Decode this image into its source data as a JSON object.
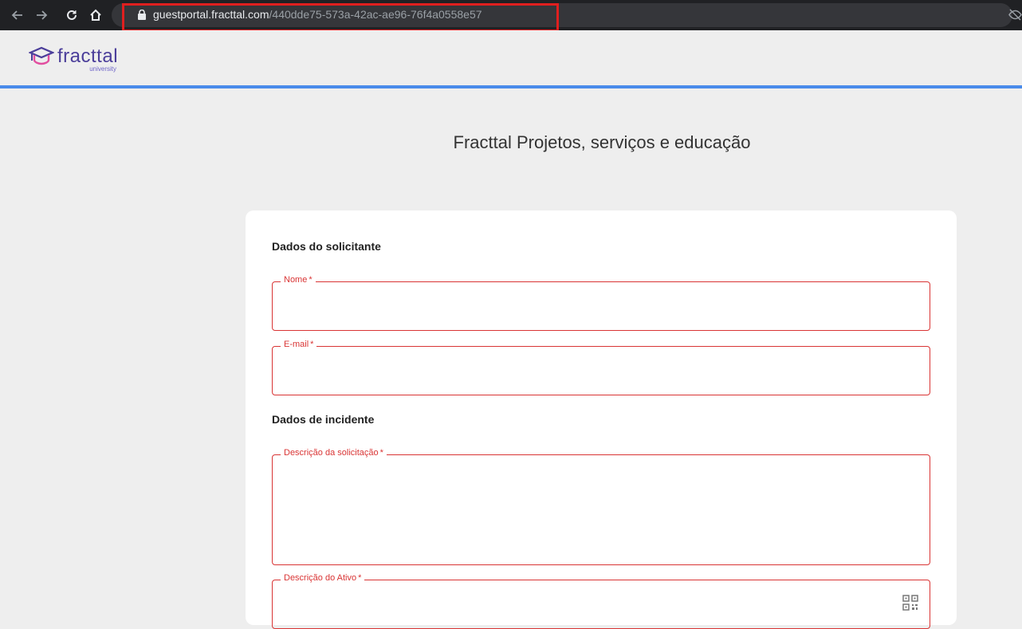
{
  "browser": {
    "url_domain": "guestportal.fracttal.com",
    "url_path": "/440dde75-573a-42ac-ae96-76f4a0558e57",
    "highlight_color": "#e01f1f"
  },
  "header": {
    "logo_name": "fracttal",
    "logo_sub": "university",
    "accent_color": "#4a8bea"
  },
  "page": {
    "title": "Fracttal Projetos, serviços e educação"
  },
  "form": {
    "section1_title": "Dados do solicitante",
    "name_label": "Nome",
    "email_label": "E-mail",
    "section2_title": "Dados de incidente",
    "description_label": "Descrição da solicitação",
    "asset_label": "Descrição do Ativo",
    "required_marker": "*",
    "error_color": "#d93434"
  },
  "icons": [
    "back-icon",
    "forward-icon",
    "reload-icon",
    "home-icon",
    "lock-icon",
    "eye-off-icon",
    "qr-code-icon"
  ]
}
